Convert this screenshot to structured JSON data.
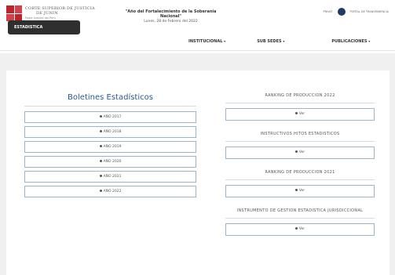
{
  "header": {
    "org_name_line1": "CORTE SUPERIOR DE JUSTICIA",
    "org_name_line2": "DE JUNIN",
    "org_subtitle": "Poder Judicial del Perú",
    "slogan_line1": "\"Año del Fortalecimiento de la Soberanía",
    "slogan_line2": "Nacional\"",
    "date": "Lunes, 28 de Febrero del 2022",
    "top_link_1": "PRIVAT",
    "top_link_2": "PORTAL DE TRANSPARENCIA"
  },
  "menu": [
    {
      "label": "INSTITUCIONAL"
    },
    {
      "label": "SUB SEDES"
    },
    {
      "label": "PUBLICACIONES"
    }
  ],
  "tab": {
    "label": "ESTADISTICA"
  },
  "left": {
    "title": "Boletines Estadísticos",
    "years": [
      "AÑO 2017",
      "AÑO 2018",
      "AÑO 2019",
      "AÑO 2020",
      "AÑO 2021",
      "AÑO 2022"
    ]
  },
  "right": {
    "sections": [
      {
        "title": "RANKING DE PRODUCCION 2022",
        "button": "Ver"
      },
      {
        "title": "INSTRUCTIVOS HITOS ESTADISTICOS",
        "button": "Ver"
      },
      {
        "title": "RANKING DE PRODUCCION 2021",
        "button": "Ver"
      },
      {
        "title": "INSTRUMENTO DE GESTION ESTADISTICA JURISDICCIONAL",
        "button": "Ver"
      }
    ]
  },
  "colors": {
    "brand_red": "#c0242b",
    "tab_dark": "#2f2f2f",
    "title_blue": "#2a5a8e"
  }
}
